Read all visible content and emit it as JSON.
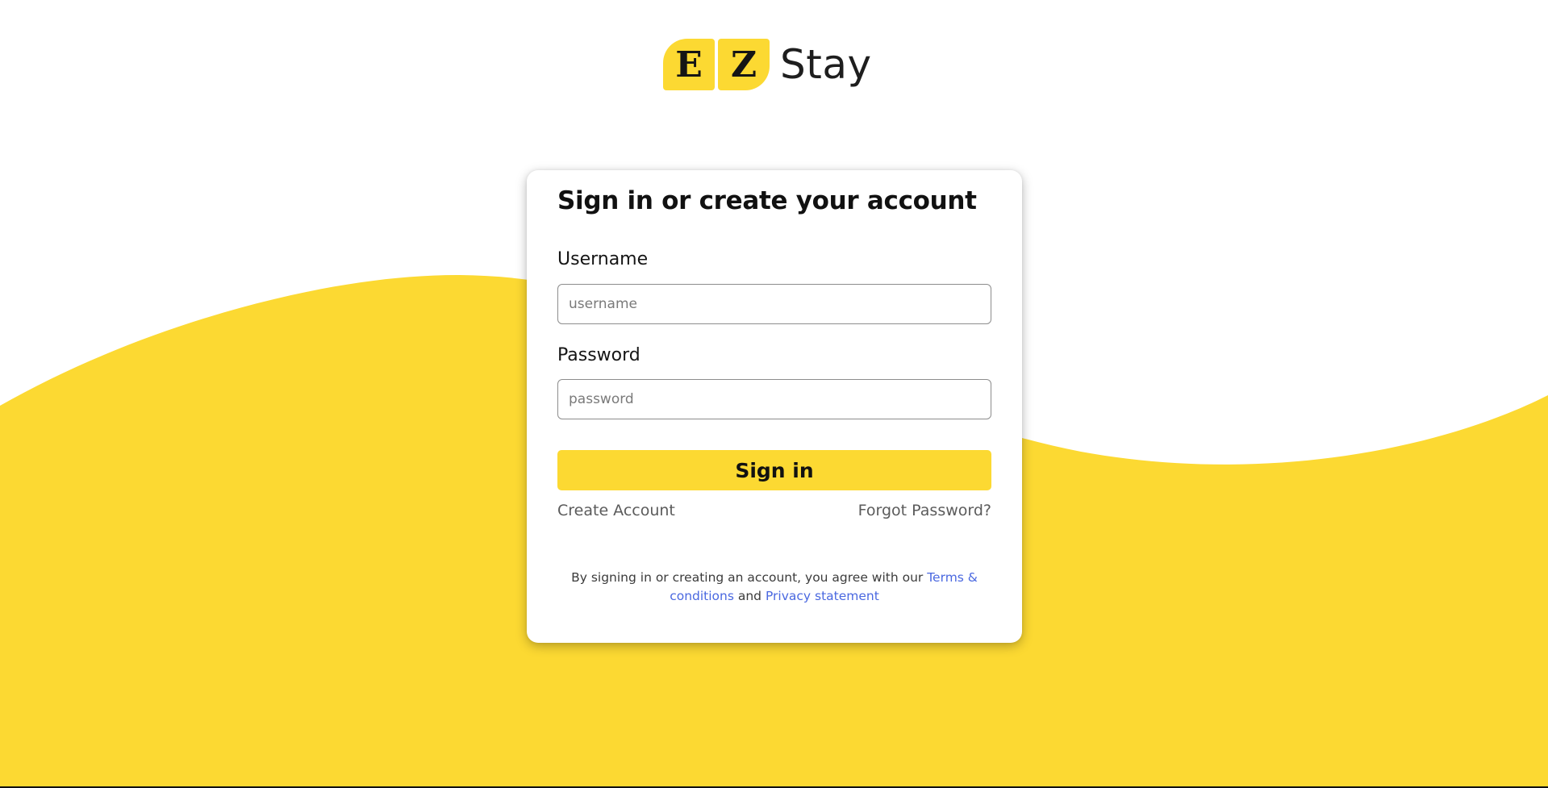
{
  "brand": {
    "logo_letters": [
      "E",
      "Z"
    ],
    "name": "Stay"
  },
  "signin": {
    "title": "Sign in or create your account",
    "username_label": "Username",
    "username_placeholder": "username",
    "password_label": "Password",
    "password_placeholder": "password",
    "submit_label": "Sign in",
    "create_account_label": "Create Account",
    "forgot_password_label": "Forgot Password?",
    "legal_prefix": "By signing in or creating an account, you agree with our ",
    "terms_label": "Terms & conditions",
    "legal_and": " and ",
    "privacy_label": "Privacy statement"
  },
  "colors": {
    "accent_yellow": "#fcd932",
    "link_blue": "#4a68e0",
    "background": "#ffffff"
  }
}
